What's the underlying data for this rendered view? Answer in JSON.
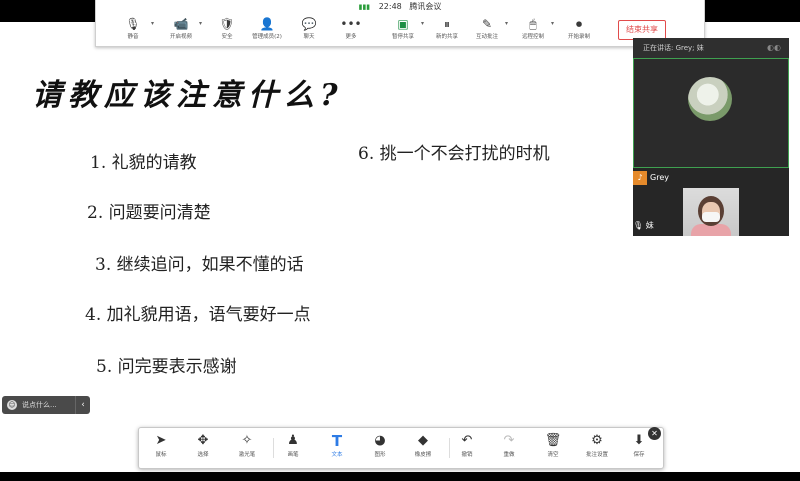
{
  "meeting_bar": {
    "time": "22:48",
    "app_name": "腾讯会议",
    "buttons": [
      {
        "label": "静音",
        "icon": "🎙",
        "caret": true
      },
      {
        "label": "开启视频",
        "icon": "📹",
        "caret": true
      },
      {
        "label": "安全",
        "icon": "🛡",
        "caret": false
      },
      {
        "label": "管理成员(2)",
        "icon": "👤",
        "caret": false
      },
      {
        "label": "聊天",
        "icon": "💬",
        "caret": false
      },
      {
        "label": "更多",
        "icon": "•••",
        "caret": false
      },
      {
        "label": "暂停共享",
        "icon": "▣",
        "caret": true
      },
      {
        "label": "新的共享",
        "icon": "⏸",
        "caret": false
      },
      {
        "label": "互动批注",
        "icon": "✎",
        "caret": true
      },
      {
        "label": "远程控制",
        "icon": "🖱",
        "caret": true
      },
      {
        "label": "开始录制",
        "icon": "⏺",
        "caret": false
      }
    ],
    "end_share_label": "结束共享"
  },
  "slide": {
    "title": "请教应该注意什么?",
    "bullets": [
      "1. 礼貌的请教",
      "2. 问题要问清楚",
      "3. 继续追问，如果不懂的话",
      "4. 加礼貌用语，语气要好一点",
      "5. 问完要表示感谢",
      "6. 挑一个不会打扰的时机"
    ]
  },
  "video_panel": {
    "header": "正在讲话: Grey; 妹",
    "participant_1": "Grey",
    "participant_2": "妹"
  },
  "chat": {
    "placeholder": "说点什么...",
    "collapse_icon": "‹"
  },
  "annotation_bar": {
    "tools": [
      {
        "label": "鼠标",
        "icon": "➤"
      },
      {
        "label": "选择",
        "icon": "✥"
      },
      {
        "label": "激光笔",
        "icon": "✧"
      },
      {
        "label": "画笔",
        "icon": "♟"
      },
      {
        "label": "文本",
        "icon": "T"
      },
      {
        "label": "图形",
        "icon": "◕"
      },
      {
        "label": "橡皮擦",
        "icon": "◆"
      },
      {
        "label": "撤销",
        "icon": "↶"
      },
      {
        "label": "重做",
        "icon": "↷"
      },
      {
        "label": "清空",
        "icon": "🗑"
      },
      {
        "label": "批注设置",
        "icon": "⚙"
      },
      {
        "label": "保存",
        "icon": "⬇"
      }
    ],
    "close_icon": "✕"
  }
}
